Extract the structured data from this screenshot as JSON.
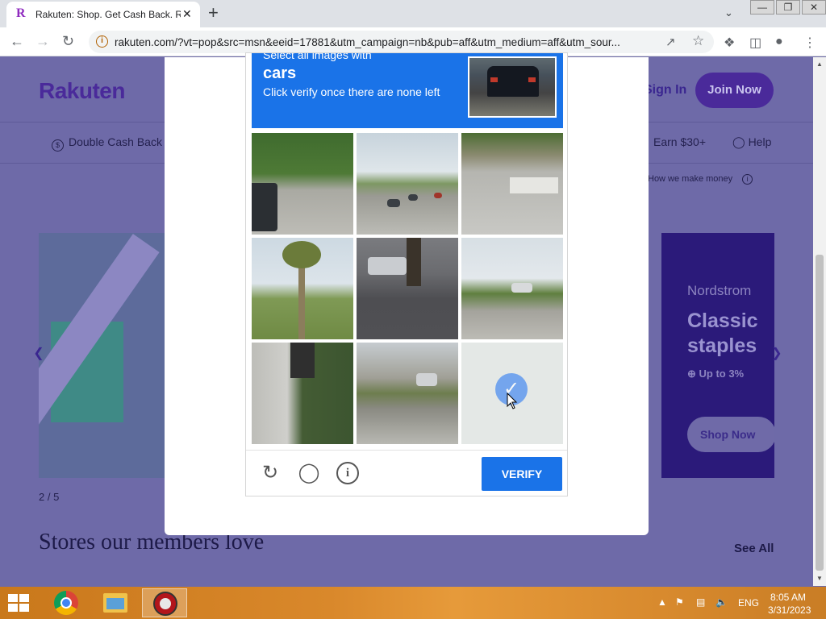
{
  "browser": {
    "tab_title": "Rakuten: Shop. Get Cash Back. Re",
    "tab_favicon": "R",
    "tab_close": "✕",
    "new_tab": "+",
    "tab_dropdown": "⌄",
    "url": "rakuten.com/?vt=pop&src=msn&eeid=17881&utm_campaign=nb&pub=aff&utm_medium=aff&utm_sour...",
    "info_icon": "i",
    "window_controls": [
      "—",
      "❐",
      "✕"
    ]
  },
  "page": {
    "logo": "Rakuten",
    "sign_in": "Sign In",
    "join_now": "Join Now",
    "double_cash_back": "Double Cash Back",
    "earn": "Earn $30+",
    "help": "Help",
    "how_we_make_money": "How we make money",
    "carousel_pager": "2 / 5",
    "promo_store": "Nordstrom",
    "promo_headline": "Classic staples",
    "promo_offer": "⊕ Up to 3%",
    "promo_shop_now": "Shop Now",
    "stores_heading": "Stores our members love",
    "see_all": "See All"
  },
  "captcha": {
    "select_text": "Select all images with",
    "target": "cars",
    "instruction": "Click verify once there are none left",
    "verify_label": "VERIFY",
    "selected_tiles": [
      8
    ]
  },
  "taskbar": {
    "language": "ENG",
    "time": "8:05 AM",
    "date": "3/31/2023"
  },
  "colors": {
    "captcha_blue": "#1a73e8",
    "rakuten_purple": "#4a2a9a",
    "overlay_page": "#6e6aa8",
    "taskbar_orange": "#d9882b"
  }
}
